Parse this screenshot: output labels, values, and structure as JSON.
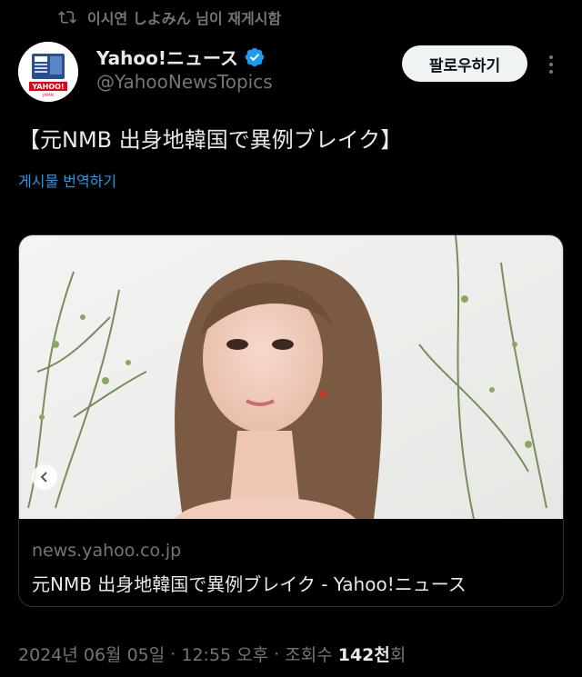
{
  "repost": {
    "text": "이시연 しよみん 님이 재게시함"
  },
  "author": {
    "name": "Yahoo!ニュース",
    "handle": "@YahooNewsTopics",
    "avatar_text": "YAHOO!",
    "avatar_subtext": "JAPAN"
  },
  "follow_label": "팔로우하기",
  "post": {
    "title": "【元NMB 出身地韓国で異例ブレイク】",
    "translate_label": "게시물 번역하기"
  },
  "card": {
    "domain": "news.yahoo.co.jp",
    "title": "元NMB 出身地韓国で異例ブレイク - Yahoo!ニュース"
  },
  "meta": {
    "date": "2024년 06월 05일",
    "sep1": " · ",
    "time": "12:55 오후",
    "sep2": " · ",
    "views_label": "조회수 ",
    "views_count": "142천",
    "views_suffix": "회"
  },
  "colors": {
    "accent": "#1d9bf0",
    "verified": "#1d9bf0",
    "muted": "#71767b"
  }
}
